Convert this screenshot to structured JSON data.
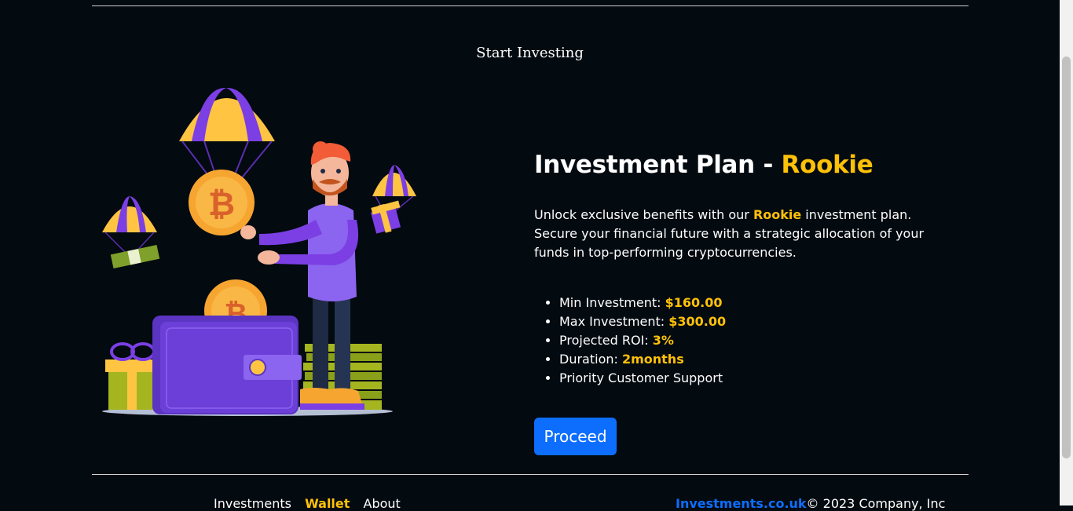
{
  "header": {
    "title": "Start Investing"
  },
  "plan": {
    "title_prefix": "Investment Plan - ",
    "name": "Rookie",
    "desc_before": "Unlock exclusive benefits with our ",
    "desc_highlight": "Rookie",
    "desc_after": " investment plan. Secure your financial future with a strategic allocation of your funds in top-performing cryptocurrencies.",
    "features": [
      {
        "label": "Min Investment: ",
        "value": "$160.00"
      },
      {
        "label": "Max Investment: ",
        "value": "$300.00"
      },
      {
        "label": "Projected ROI: ",
        "value": "3%"
      },
      {
        "label": "Duration: ",
        "value": "2months"
      },
      {
        "label": "Priority Customer Support",
        "value": ""
      }
    ],
    "proceed_label": "Proceed"
  },
  "footer": {
    "nav": [
      "Investments",
      "Wallet",
      "About"
    ],
    "brand": "Investments.co.uk",
    "copyright": "© 2023 Company, Inc"
  },
  "illustration": {
    "icon": "crypto-investor-illustration",
    "coin_symbol": "₿"
  },
  "colors": {
    "accent": "#ffc107",
    "primary": "#0d6efd",
    "background": "#030a10"
  }
}
